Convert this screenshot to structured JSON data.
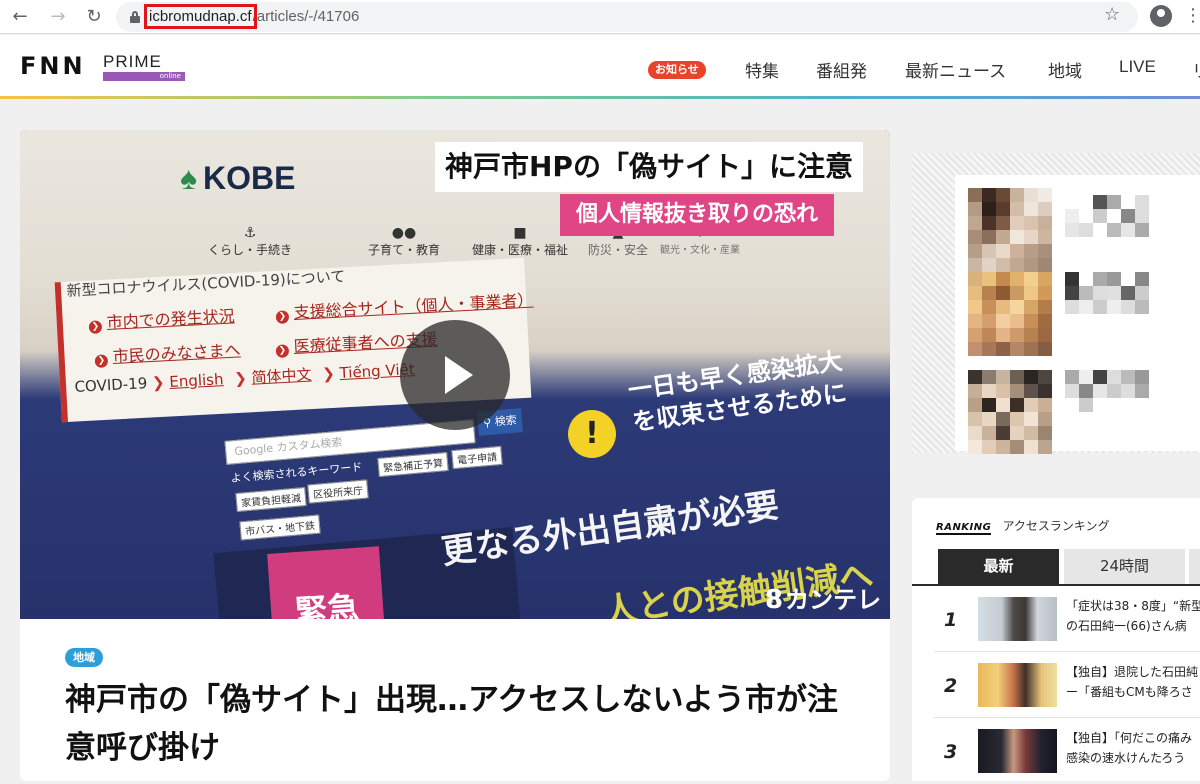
{
  "browser": {
    "url_host": "icbromudnap.cf",
    "url_path": "/articles/-/41706"
  },
  "site": {
    "logo_text": "FNN",
    "logo_sub": "PRIME",
    "logo_online": "online",
    "notice_badge": "お知らせ",
    "nav": [
      "特集",
      "番組発",
      "最新ニュース",
      "地域",
      "LIVE",
      "リ"
    ]
  },
  "article": {
    "video": {
      "tv_title": "神戸市HPの「偽サイト」に注意",
      "tv_subtitle": "個人情報抜き取りの恐れ",
      "station": "カンテレ",
      "station_mark": "8",
      "screen": {
        "logo": "KOBE",
        "tabs": [
          "くらし・手続き",
          "子育て・教育",
          "健康・医療・福祉",
          "防災・安全",
          "観光・文化・産業"
        ],
        "covid_title": "新型コロナウイルス(COVID-19)について",
        "links": [
          "市内での発生状況",
          "支援総合サイト（個人・事業者）",
          "市民のみなさまへ",
          "医療従事者への支援"
        ],
        "lang_label": "COVID-19",
        "lang_links": [
          "English",
          "简体中文",
          "Tiếng Việt"
        ],
        "search_placeholder": "カスタム検索",
        "search_google": "Google",
        "search_button": "検索",
        "keywords_title": "よく検索されるキーワード",
        "keywords": [
          "緊急補正予算",
          "電子申請",
          "家賃負担軽減",
          "区役所来庁",
          "市バス・地下鉄"
        ],
        "slogan_lines": [
          "一日も早く感染拡大",
          "を収束させるために"
        ],
        "slogan_main": "更なる外出自粛が必要",
        "slogan_bottom": "人との接触削減へ",
        "emergency": "緊急"
      }
    },
    "tag": "地域",
    "headline": "神戸市の「偽サイト」出現…アクセスしないよう市が注意呼び掛け"
  },
  "ranking": {
    "logo": "RANKING",
    "title": "アクセスランキング",
    "tabs": [
      "最新",
      "24時間"
    ],
    "items": [
      {
        "rank": "1",
        "text_line1": "「症状は38・8度」“新型",
        "text_line2": "の石田純一(66)さん病"
      },
      {
        "rank": "2",
        "text_line1": "【独自】退院した石田純",
        "text_line2": "ー「番組もCMも降ろさ"
      },
      {
        "rank": "3",
        "text_line1": "【独自】「何だこの痛み",
        "text_line2": "感染の速水けんたろう"
      }
    ]
  },
  "colors": {
    "highlight_box": "#e0141b",
    "tv_subtitle_bg": "#e04585",
    "tag_bg": "#2d9ed8",
    "notice_bg": "#e8442a"
  }
}
